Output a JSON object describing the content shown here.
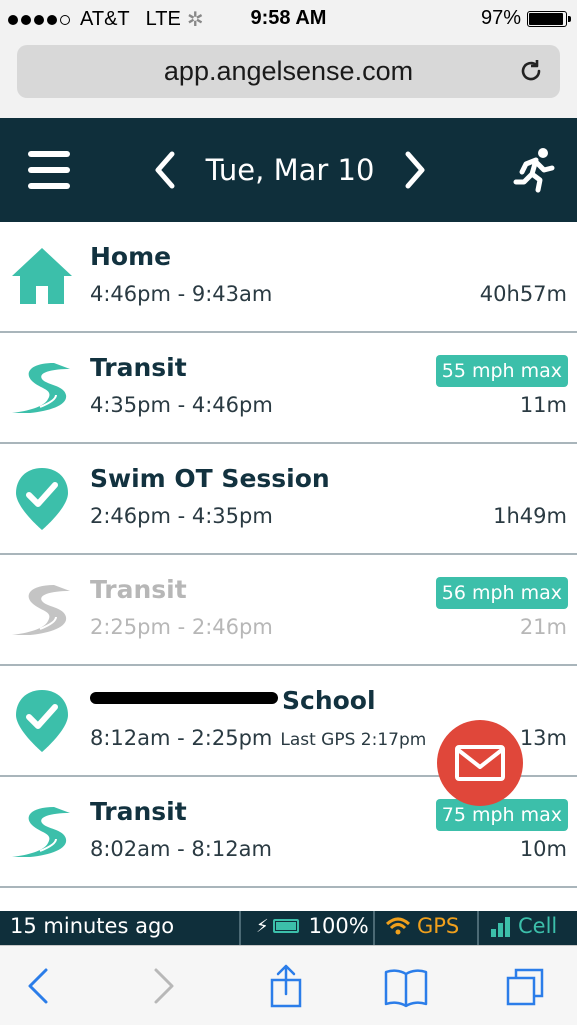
{
  "status_bar": {
    "carrier": "AT&T",
    "network": "LTE",
    "time": "9:58 AM",
    "battery": "97%"
  },
  "browser": {
    "url": "app.angelsense.com"
  },
  "header": {
    "date": "Tue, Mar 10"
  },
  "timeline": [
    {
      "type": "home",
      "title": "Home",
      "times": "4:46pm - 9:43am",
      "duration": "40h57m",
      "speed_badge": "",
      "faded": false
    },
    {
      "type": "transit",
      "title": "Transit",
      "times": "4:35pm - 4:46pm",
      "duration": "11m",
      "speed_badge": "55 mph max",
      "faded": false
    },
    {
      "type": "place",
      "title": "Swim OT Session",
      "times": "2:46pm - 4:35pm",
      "duration": "1h49m",
      "speed_badge": "",
      "faded": false
    },
    {
      "type": "transit",
      "title": "Transit",
      "times": "2:25pm - 2:46pm",
      "duration": "21m",
      "speed_badge": "56 mph max",
      "faded": true
    },
    {
      "type": "place",
      "title": "School",
      "times": "8:12am - 2:25pm",
      "last_gps": "Last GPS 2:17pm",
      "duration": "13m",
      "speed_badge": "",
      "faded": false
    },
    {
      "type": "transit",
      "title": "Transit",
      "times": "8:02am - 8:12am",
      "duration": "10m",
      "speed_badge": "75 mph max",
      "faded": false
    }
  ],
  "device_status": {
    "last_update": "15 minutes ago",
    "battery": "100%",
    "gps_label": "GPS",
    "cell_label": "Cell"
  },
  "colors": {
    "header_bg": "#0f2f3b",
    "accent": "#3cbfaa",
    "mail": "#e0473a",
    "gps": "#f0a01c"
  },
  "icons": {
    "menu": "hamburger-icon",
    "prev": "chevron-left-icon",
    "next": "chevron-right-icon",
    "activity": "runner-icon",
    "mail": "mail-icon"
  }
}
